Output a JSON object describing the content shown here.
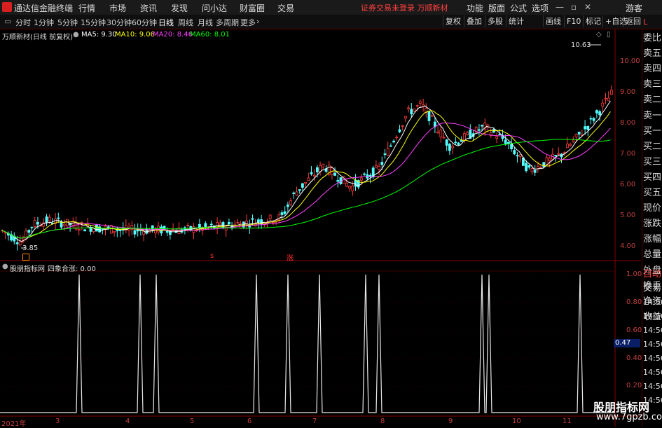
{
  "menu": {
    "app_title": "通达信金融终端",
    "items": [
      "行情",
      "市场",
      "资讯",
      "发现",
      "问小达",
      "财富圈",
      "交易"
    ],
    "alert": "证券交易未登录  万顺新材",
    "right_items": [
      "功能",
      "版面",
      "公式",
      "选项"
    ],
    "guest": "游客"
  },
  "toolbar": {
    "periods": [
      "分时",
      "1分钟",
      "5分钟",
      "15分钟",
      "30分钟",
      "60分钟",
      "日线",
      "周线",
      "月线",
      "多周期",
      "更多"
    ],
    "active_period": "日线",
    "right_buttons": [
      "复权",
      "叠加",
      "多股",
      "统计",
      "画线",
      "F10",
      "标记",
      "+自选",
      "返回"
    ]
  },
  "chart": {
    "stock_label": "万顺新材(日线 前复权)",
    "ma": [
      {
        "label": "MA5: 9.30",
        "color": "#ffffff"
      },
      {
        "label": "MA10: 9.06",
        "color": "#ffff00"
      },
      {
        "label": "MA20: 8.46",
        "color": "#ff40ff"
      },
      {
        "label": "MA60: 8.01",
        "color": "#00ff00"
      }
    ],
    "high_marker": "10.63",
    "low_marker": "3.85",
    "y_ticks": [
      "10.00",
      "9.00",
      "8.00",
      "7.00",
      "6.00",
      "5.00",
      "4.00"
    ],
    "signal_marks": [
      "s",
      "涨"
    ]
  },
  "indicator": {
    "name": "股朋指标网",
    "series_label": "四象合涨: 0.00",
    "y_ticks": [
      "1.00",
      "0.80",
      "0.60",
      "0.40",
      "0.20"
    ],
    "current_value": "0.47"
  },
  "x_axis": [
    "2021年",
    "3",
    "4",
    "5",
    "6",
    "7",
    "8",
    "9",
    "10",
    "11"
  ],
  "sidebar": {
    "top_label": "L",
    "items": [
      "委比",
      "卖五",
      "卖四",
      "卖三",
      "卖二",
      "卖一",
      "买一",
      "买二",
      "买三",
      "买四",
      "买五",
      "现价",
      "涨跌",
      "涨幅",
      "总量",
      "外盘",
      "换手",
      "净资",
      "收益"
    ],
    "lower": [
      "自动",
      "交易",
      "14:56",
      "14:56",
      "14:56",
      "14:56",
      "14:56",
      "14:56",
      "14:56",
      "14:56"
    ]
  },
  "watermark": {
    "line1": "股朋指标网",
    "line2": "www.7gpzb.com"
  },
  "chart_data": {
    "type": "line",
    "title": "",
    "series": [
      {
        "name": "四象合涨",
        "x": [
          1,
          2,
          3,
          4,
          5,
          6,
          7,
          8,
          9,
          10,
          11
        ],
        "values": [
          0,
          1,
          0,
          1,
          1,
          0,
          1,
          1,
          0,
          1,
          0
        ]
      }
    ]
  }
}
